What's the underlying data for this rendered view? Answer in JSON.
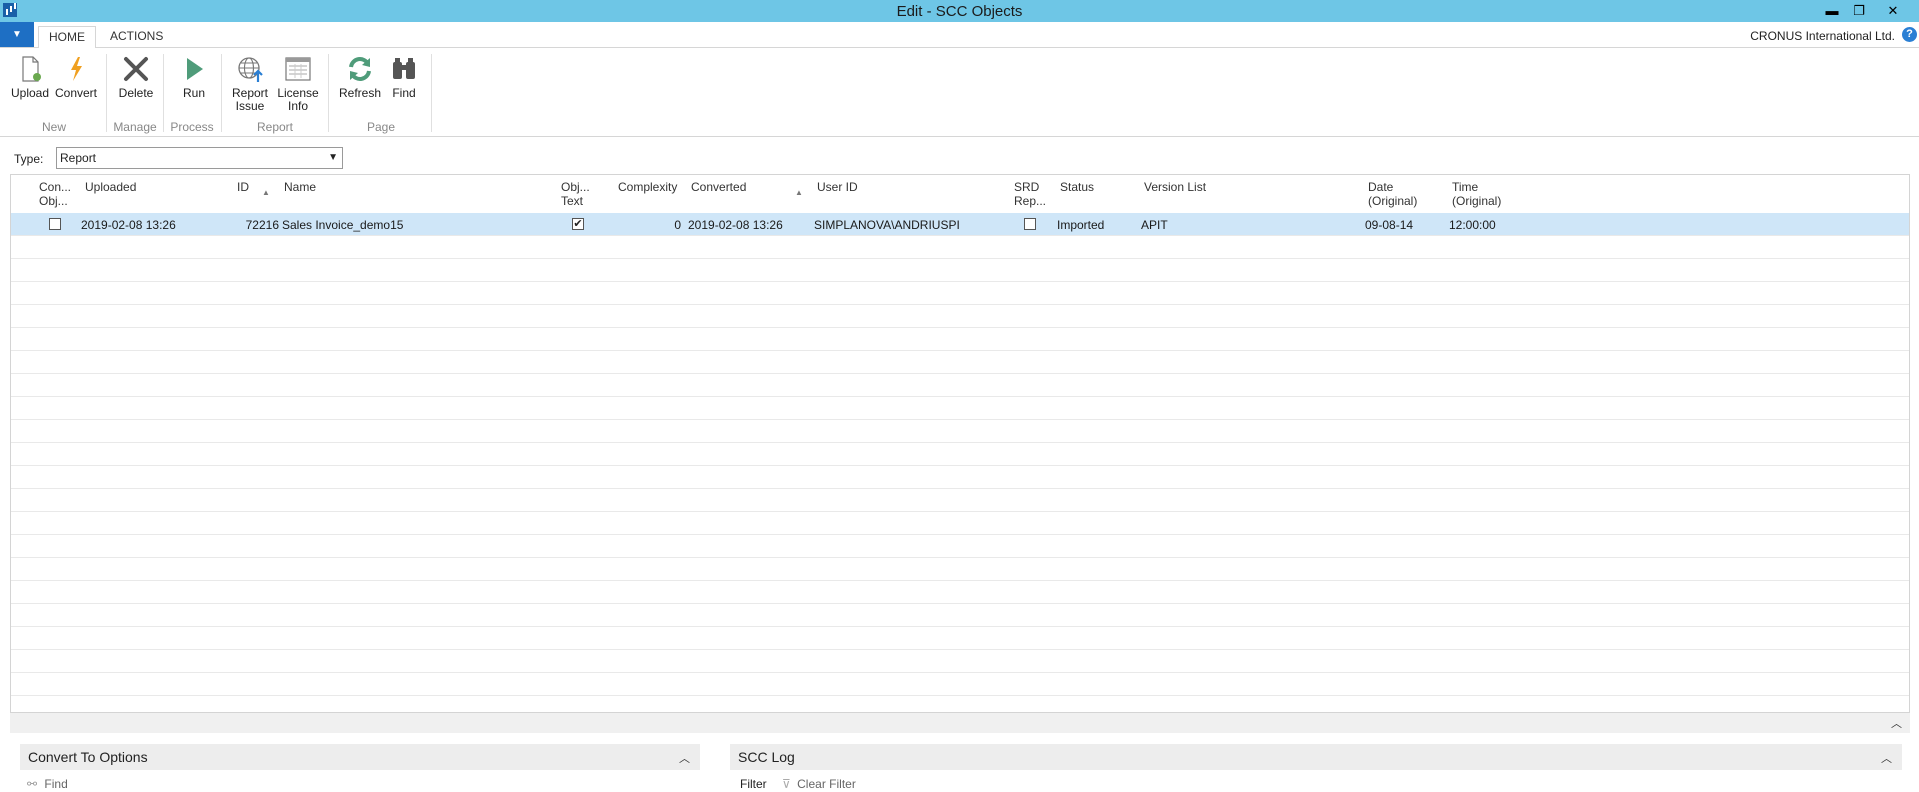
{
  "window": {
    "title": "Edit - SCC Objects",
    "minimize": "▬",
    "restore": "❐",
    "close": "✕"
  },
  "ribbon_tabs": [
    {
      "label": "HOME"
    },
    {
      "label": "ACTIONS"
    }
  ],
  "company": "CRONUS International Ltd.",
  "help": "?",
  "ribbon": {
    "buttons": [
      {
        "id": "upload",
        "label": "Upload"
      },
      {
        "id": "convert",
        "label": "Convert"
      },
      {
        "id": "delete",
        "label": "Delete"
      },
      {
        "id": "run",
        "label": "Run"
      },
      {
        "id": "report_issue",
        "label1": "Report",
        "label2": "Issue"
      },
      {
        "id": "license_info",
        "label1": "License",
        "label2": "Info"
      },
      {
        "id": "refresh",
        "label": "Refresh"
      },
      {
        "id": "find",
        "label": "Find"
      }
    ],
    "groups": [
      "New",
      "Manage",
      "Process",
      "Report",
      "Page"
    ]
  },
  "filter": {
    "label": "Type:",
    "value": "Report"
  },
  "columns": {
    "con_obj1": "Con...",
    "con_obj2": "Obj...",
    "uploaded": "Uploaded",
    "id": "ID",
    "name": "Name",
    "obj_text1": "Obj...",
    "obj_text2": "Text",
    "complexity": "Complexity",
    "converted": "Converted",
    "user_id": "User ID",
    "srd1": "SRD",
    "srd2": "Rep...",
    "status": "Status",
    "version_list": "Version List",
    "date1": "Date",
    "date2": "(Original)",
    "time1": "Time",
    "time2": "(Original)"
  },
  "rows": [
    {
      "uploaded": "2019-02-08 13:26",
      "id": "72216",
      "name": "Sales Invoice_demo15",
      "obj_text_checked": true,
      "complexity": "0",
      "converted": "2019-02-08 13:26",
      "user_id": "SIMPLANOVA\\ANDRIUSPI",
      "srd_checked": false,
      "status": "Imported",
      "version_list": "APIT",
      "date": "09-08-14",
      "time": "12:00:00",
      "con_obj_checked": false
    }
  ],
  "factboxes": {
    "left": {
      "title": "Convert To Options",
      "action": "Find"
    },
    "right": {
      "title": "SCC Log",
      "filter": "Filter",
      "clear_filter": "Clear Filter"
    }
  }
}
